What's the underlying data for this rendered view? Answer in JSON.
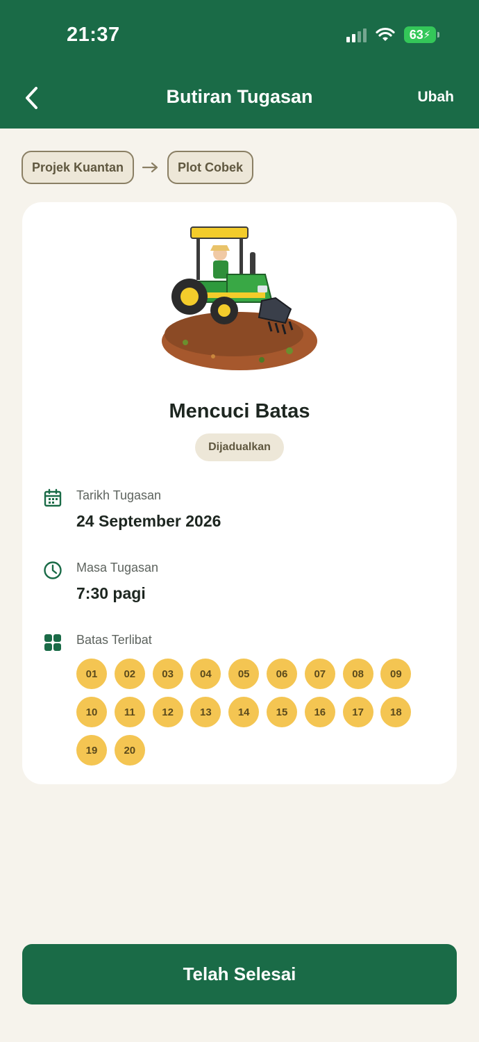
{
  "status_bar": {
    "time": "21:37",
    "battery": "63"
  },
  "nav": {
    "title": "Butiran Tugasan",
    "edit_label": "Ubah"
  },
  "breadcrumb": {
    "items": [
      "Projek Kuantan",
      "Plot Cobek"
    ]
  },
  "task": {
    "title": "Mencuci Batas",
    "status": "Dijadualkan",
    "date_label": "Tarikh Tugasan",
    "date_value": "24 September 2026",
    "time_label": "Masa Tugasan",
    "time_value": "7:30 pagi",
    "plots_label": "Batas Terlibat",
    "plots": [
      "01",
      "02",
      "03",
      "04",
      "05",
      "06",
      "07",
      "08",
      "09",
      "10",
      "11",
      "12",
      "13",
      "14",
      "15",
      "16",
      "17",
      "18",
      "19",
      "20"
    ]
  },
  "actions": {
    "done_label": "Telah Selesai"
  },
  "colors": {
    "primary": "#1a6b47",
    "plot_badge": "#f4c552",
    "background": "#f6f3ec"
  }
}
